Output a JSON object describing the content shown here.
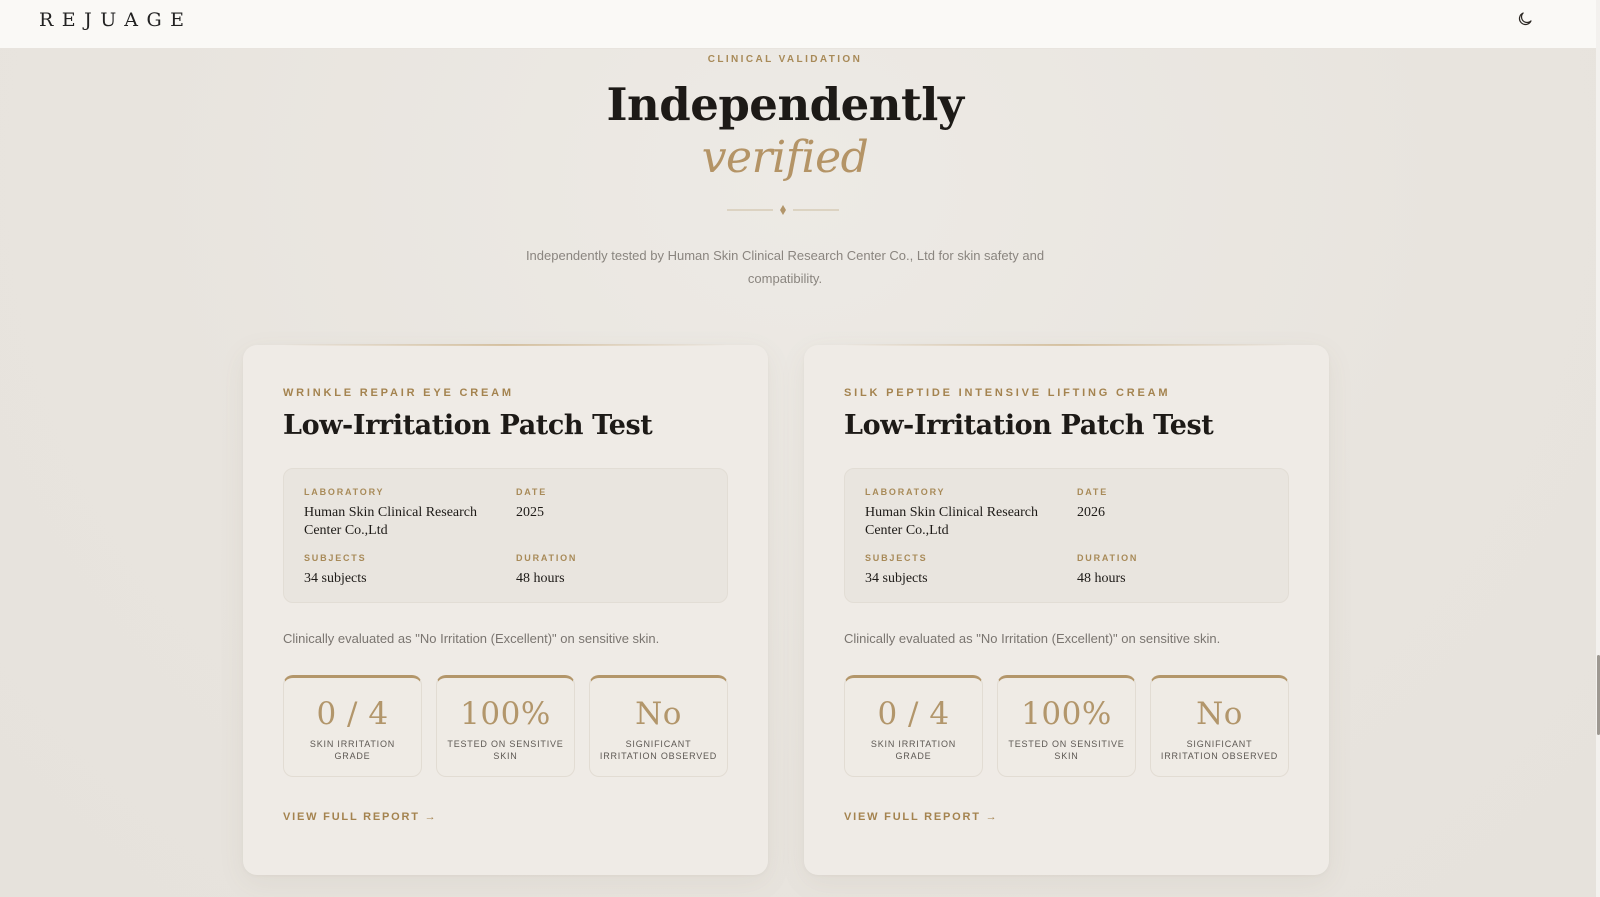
{
  "nav": {
    "logo": "REJUAGE",
    "theme_toggle_icon": "moon-icon"
  },
  "hero": {
    "eyebrow": "CLINICAL VALIDATION",
    "title": "Independently",
    "title_accent": "verified",
    "description": "Independently tested by Human Skin Clinical Research Center Co., Ltd for skin safety and compatibility."
  },
  "colors": {
    "accent_gold": "#b2966b",
    "background": "#e9e5e0",
    "card": "#efebe6"
  },
  "cards": [
    {
      "product": "WRINKLE REPAIR EYE CREAM",
      "title": "Low-Irritation Patch Test",
      "laboratory_label": "LABORATORY",
      "laboratory": "Human Skin Clinical Research Center Co.,Ltd",
      "date_label": "DATE",
      "date": "2025",
      "subjects_label": "SUBJECTS",
      "subjects": "34 subjects",
      "duration_label": "DURATION",
      "duration": "48 hours",
      "description": "Clinically evaluated as \"No Irritation (Excellent)\" on sensitive skin.",
      "stats": [
        {
          "value": "0 / 4",
          "caption": "SKIN IRRITATION GRADE"
        },
        {
          "value": "100%",
          "caption": "TESTED ON SENSITIVE SKIN"
        },
        {
          "value": "No",
          "caption": "SIGNIFICANT IRRITATION OBSERVED"
        }
      ],
      "link": "VIEW FULL REPORT →"
    },
    {
      "product": "SILK PEPTIDE INTENSIVE LIFTING CREAM",
      "title": "Low-Irritation Patch Test",
      "laboratory_label": "LABORATORY",
      "laboratory": "Human Skin Clinical Research Center Co.,Ltd",
      "date_label": "DATE",
      "date": "2026",
      "subjects_label": "SUBJECTS",
      "subjects": "34 subjects",
      "duration_label": "DURATION",
      "duration": "48 hours",
      "description": "Clinically evaluated as \"No Irritation (Excellent)\" on sensitive skin.",
      "stats": [
        {
          "value": "0 / 4",
          "caption": "SKIN IRRITATION GRADE"
        },
        {
          "value": "100%",
          "caption": "TESTED ON SENSITIVE SKIN"
        },
        {
          "value": "No",
          "caption": "SIGNIFICANT IRRITATION OBSERVED"
        }
      ],
      "link": "VIEW FULL REPORT →"
    }
  ]
}
